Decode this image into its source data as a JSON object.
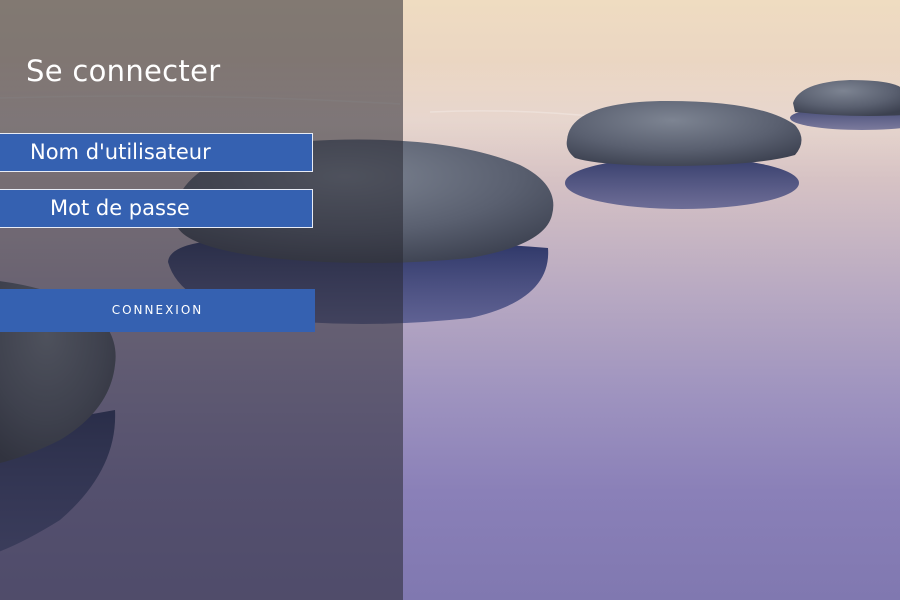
{
  "login": {
    "title": "Se connecter",
    "username_placeholder": "Nom d'utilisateur",
    "password_placeholder": "Mot de passe",
    "submit_label": "CONNEXION"
  },
  "colors": {
    "accent": "#3561b1",
    "panel_overlay": "rgba(40,40,50,0.55)",
    "text": "#ffffff"
  }
}
